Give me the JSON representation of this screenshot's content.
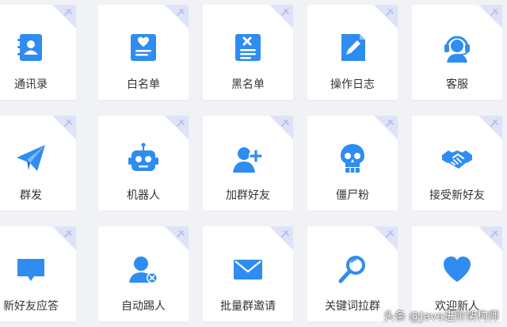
{
  "colors": {
    "icon_primary": "#2f8cf0",
    "icon_light": "#ffffff",
    "corner": "#dfe3f8",
    "corner_mark": "#b3bde8"
  },
  "tiles": [
    {
      "label": "通讯录",
      "icon": "contacts-book-icon"
    },
    {
      "label": "白名单",
      "icon": "whitelist-heart-icon"
    },
    {
      "label": "黑名单",
      "icon": "blacklist-x-icon"
    },
    {
      "label": "操作日志",
      "icon": "operation-log-pencil-icon"
    },
    {
      "label": "客服",
      "icon": "customer-service-headset-icon"
    },
    {
      "label": "群发",
      "icon": "paper-plane-icon"
    },
    {
      "label": "机器人",
      "icon": "robot-icon"
    },
    {
      "label": "加群好友",
      "icon": "add-friend-user-plus-icon"
    },
    {
      "label": "僵尸粉",
      "icon": "skull-icon"
    },
    {
      "label": "接受新好友",
      "icon": "handshake-icon"
    },
    {
      "label": "新好友应答",
      "icon": "chat-bubble-icon"
    },
    {
      "label": "自动踢人",
      "icon": "user-remove-icon"
    },
    {
      "label": "批量群邀请",
      "icon": "envelope-icon"
    },
    {
      "label": "关键词拉群",
      "icon": "magnifier-icon"
    },
    {
      "label": "欢迎新人",
      "icon": "heart-icon"
    }
  ],
  "watermark": "头条 @Java进阶架构师"
}
